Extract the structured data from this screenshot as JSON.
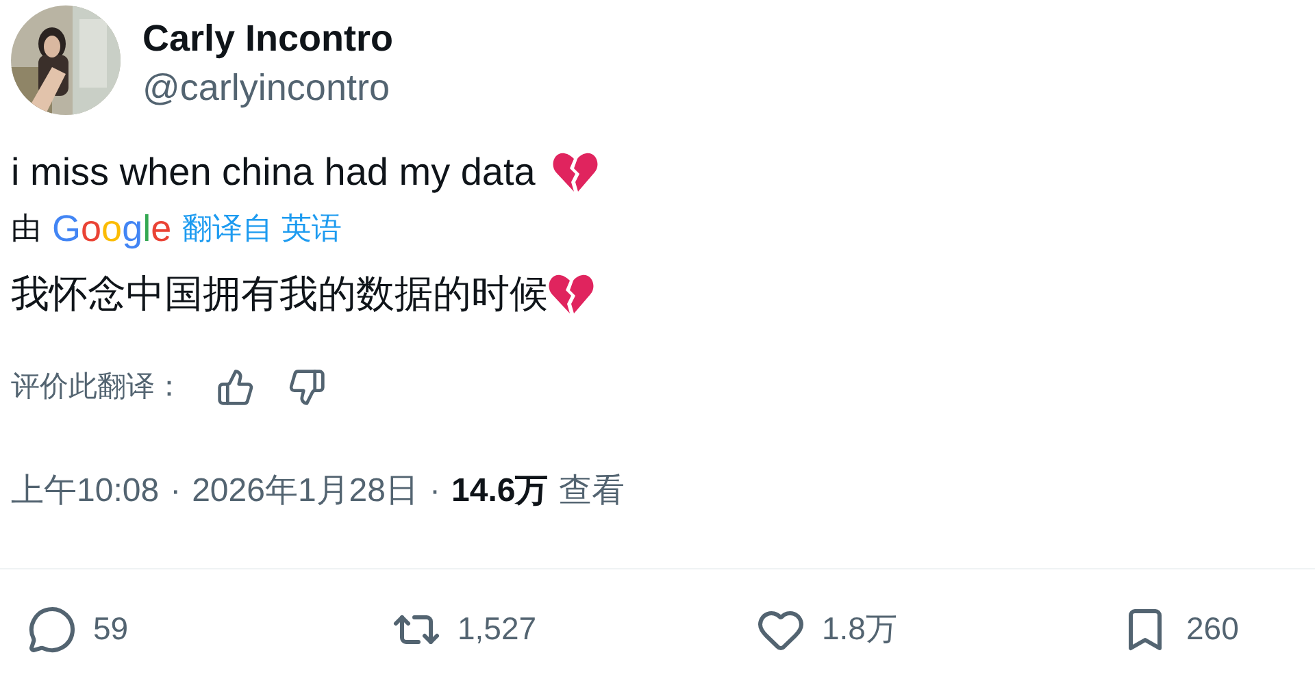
{
  "author": {
    "name": "Carly Incontro",
    "handle": "@carlyincontro"
  },
  "tweet": {
    "text": "i miss when china had my data"
  },
  "translation": {
    "by": "由",
    "brand": "Google",
    "from": "翻译自 英语",
    "text": "我怀念中国拥有我的数据的时候",
    "rate_label": "评价此翻译："
  },
  "meta": {
    "time": "上午10:08",
    "separator": "·",
    "date": "2026年1月28日",
    "views": "14.6万",
    "views_label": "查看"
  },
  "stats": [
    {
      "kind": "reply",
      "count": "59"
    },
    {
      "kind": "repost",
      "count": "1,527"
    },
    {
      "kind": "like",
      "count": "1.8万"
    },
    {
      "kind": "bookmark",
      "count": "260"
    }
  ]
}
